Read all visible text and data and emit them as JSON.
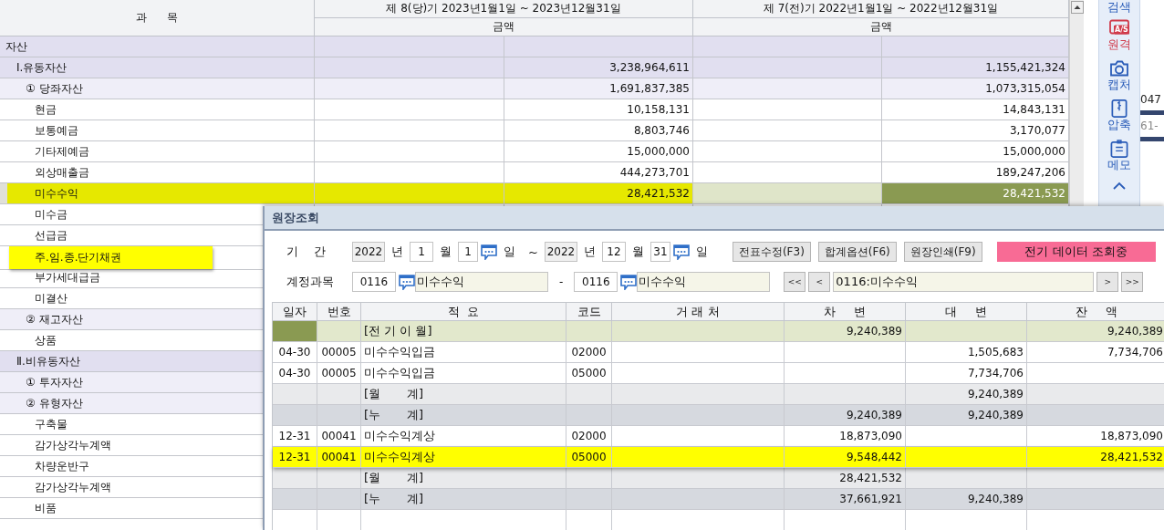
{
  "sheet": {
    "subject_header": "과      목",
    "current_period": "제 8(당)기 2023년1월1일 ~ 2023년12월31일",
    "prior_period": "제 7(전)기 2022년1월1일 ~ 2022년12월31일",
    "current_amount_header": "금액",
    "prior_amount_header": "금액",
    "rows": [
      {
        "label": "자산",
        "selected": false,
        "marked": false,
        "children": [
          {
            "label": "Ⅰ.유동자산",
            "current": "3,238,964,611",
            "prior": "1,155,421,324",
            "selected": false,
            "marked": false,
            "children": [
              {
                "label": "① 당좌자산",
                "current": "1,691,837,385",
                "prior": "1,073,315,054",
                "selected": false,
                "marked": false,
                "children": [
                  {
                    "label": "현금",
                    "current": "10,158,131",
                    "prior": "14,843,131",
                    "selected": false,
                    "marked": false
                  },
                  {
                    "label": "보통예금",
                    "current": "8,803,746",
                    "prior": "3,170,077",
                    "selected": false,
                    "marked": false
                  },
                  {
                    "label": "기타제예금",
                    "current": "15,000,000",
                    "prior": "15,000,000",
                    "selected": false,
                    "marked": false
                  },
                  {
                    "label": "외상매출금",
                    "current": "444,273,701",
                    "prior": "189,247,206",
                    "selected": false,
                    "marked": false
                  },
                  {
                    "label": "미수수익",
                    "current": "28,421,532",
                    "prior": "28,421,532",
                    "selected": true,
                    "marked": false
                  },
                  {
                    "label": "미수금",
                    "selected": false,
                    "marked": false
                  },
                  {
                    "label": "선급금",
                    "selected": false,
                    "marked": false
                  },
                  {
                    "label": "주.임.종.단기채권",
                    "selected": false,
                    "marked": true
                  },
                  {
                    "label": "부가세대급금",
                    "selected": false,
                    "marked": false
                  },
                  {
                    "label": "미결산",
                    "selected": false,
                    "marked": false
                  }
                ]
              },
              {
                "label": "② 재고자산",
                "selected": false,
                "marked": false,
                "children": [
                  {
                    "label": "상품",
                    "selected": false,
                    "marked": false
                  }
                ]
              }
            ]
          },
          {
            "label": "Ⅱ.비유동자산",
            "selected": false,
            "marked": false,
            "children": [
              {
                "label": "① 투자자산",
                "selected": false,
                "marked": false
              },
              {
                "label": "② 유형자산",
                "selected": false,
                "marked": false,
                "children": [
                  {
                    "label": "구축물",
                    "selected": false,
                    "marked": false
                  },
                  {
                    "label": "감가상각누계액",
                    "selected": false,
                    "marked": false
                  },
                  {
                    "label": "차량운반구",
                    "selected": false,
                    "marked": false
                  },
                  {
                    "label": "감가상각누계액",
                    "selected": false,
                    "marked": false
                  },
                  {
                    "label": "비품",
                    "selected": false,
                    "marked": false
                  }
                ]
              }
            ]
          }
        ]
      }
    ]
  },
  "toolbar": [
    {
      "kind": "search",
      "label": "검색"
    },
    {
      "kind": "remote",
      "label": "원격",
      "badge": "A/S"
    },
    {
      "kind": "capture",
      "label": "캡처"
    },
    {
      "kind": "compress",
      "label": "압축"
    },
    {
      "kind": "memo",
      "label": "메모"
    }
  ],
  "background_fragments": [
    "047",
    "61-"
  ],
  "ledger": {
    "title": "원장조회",
    "period": {
      "label": "기    간",
      "from": {
        "year": "2022",
        "year_unit": "년",
        "month": "1",
        "month_unit": "월",
        "day": "1",
        "day_unit": "일"
      },
      "tilde": "~",
      "to": {
        "year": "2022",
        "year_unit": "년",
        "month": "12",
        "month_unit": "월",
        "day": "31",
        "day_unit": "일"
      }
    },
    "buttons": [
      "전표수정(F3)",
      "합계옵션(F6)",
      "원장인쇄(F9)"
    ],
    "status_badge": "전기 데이터 조회중",
    "account": {
      "label": "계정과목",
      "from": {
        "code": "0116",
        "name": "미수수익"
      },
      "dash": "-",
      "to": {
        "code": "0116",
        "name": "미수수익"
      }
    },
    "nav": {
      "first": "<<",
      "prev": "<",
      "current": "0116:미수수익",
      "next": ">",
      "last": ">>"
    },
    "columns": [
      "일자",
      "번호",
      "적  요",
      "코드",
      "거 래 처",
      "차     변",
      "대     변",
      "잔     액"
    ],
    "rows": [
      {
        "kind": "carry",
        "memo": "[전 기 이 월]",
        "debit": "9,240,389",
        "balance": "9,240,389",
        "selected": false
      },
      {
        "kind": "entry",
        "date": "04-30",
        "no": "00005",
        "memo": "미수수익입금",
        "code": "02000",
        "credit": "1,505,683",
        "balance": "7,734,706",
        "selected": false
      },
      {
        "kind": "entry",
        "date": "04-30",
        "no": "00005",
        "memo": "미수수익입금",
        "code": "05000",
        "credit": "7,734,706",
        "selected": false
      },
      {
        "kind": "month_total",
        "memo": "[월       계]",
        "credit": "9,240,389",
        "selected": false
      },
      {
        "kind": "cumulative_total",
        "memo": "[누       계]",
        "debit": "9,240,389",
        "credit": "9,240,389",
        "selected": false
      },
      {
        "kind": "entry",
        "date": "12-31",
        "no": "00041",
        "memo": "미수수익계상",
        "code": "02000",
        "debit": "18,873,090",
        "balance": "18,873,090",
        "selected": false
      },
      {
        "kind": "entry",
        "date": "12-31",
        "no": "00041",
        "memo": "미수수익계상",
        "code": "05000",
        "debit": "9,548,442",
        "balance": "28,421,532",
        "selected": true
      },
      {
        "kind": "month_total",
        "memo": "[월       계]",
        "debit": "28,421,532",
        "selected": false
      },
      {
        "kind": "cumulative_total",
        "memo": "[누       계]",
        "debit": "37,661,921",
        "credit": "9,240,389",
        "selected": false
      }
    ]
  }
}
